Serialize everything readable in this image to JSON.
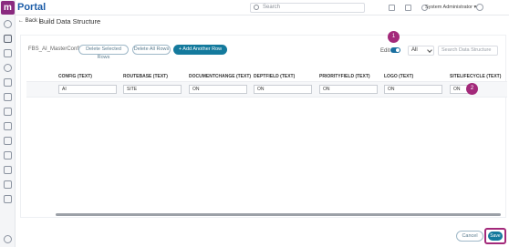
{
  "sidebar": {
    "logo": "m",
    "items": [
      "home-icon",
      "grid-icon",
      "folder-icon",
      "compass-icon",
      "graduation-icon",
      "folder-open-icon",
      "calendar-icon",
      "clipboard-icon",
      "warning-icon",
      "edit-icon",
      "chart-icon",
      "document-icon",
      "settings-icon",
      "help-icon"
    ]
  },
  "topbar": {
    "brand": "Portal",
    "search_placeholder": "Search",
    "user": "System Administrator ▾"
  },
  "breadcrumb": {
    "back": "Back",
    "title": "Build Data Structure"
  },
  "toolbar": {
    "config_name": "FBS_AI_MasterConfig",
    "delete_selected": "Delete Selected Rows",
    "delete_all": "Delete All Rows",
    "add_row": "+ Add Another Row",
    "edit_label": "Edit",
    "filter_value": "All",
    "search_placeholder": "Search Data Structure"
  },
  "table": {
    "headers": [
      "CONFIG (TEXT)",
      "ROUTEBASE (TEXT)",
      "DOCUMENTCHANGE (TEXT)",
      "DEPTFIELD (TEXT)",
      "PRIORITYFIELD (TEXT)",
      "LOGO (TEXT)",
      "SITELIFECYCLE (TEXT)"
    ],
    "rows": [
      [
        "AI",
        "SITE",
        "ON",
        "ON",
        "ON",
        "ON",
        "ON"
      ]
    ]
  },
  "markers": [
    "1",
    "2"
  ],
  "footer": {
    "cancel": "Cancel",
    "save": "Save"
  },
  "colors": {
    "accent": "#147a9d",
    "brand": "#8a2a7f",
    "marker": "#a3297a"
  }
}
